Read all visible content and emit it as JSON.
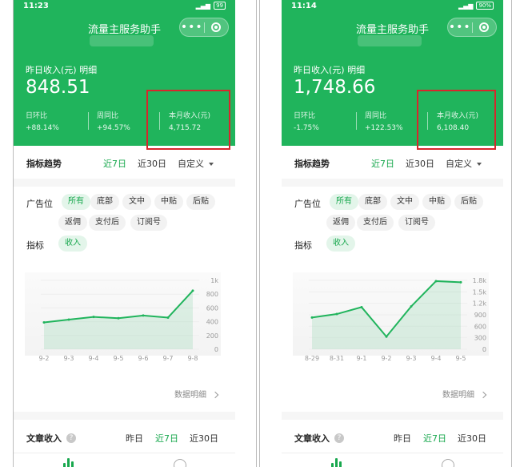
{
  "screens": [
    {
      "status_time": "11:23",
      "battery": "99",
      "app_title": "流量主服务助手",
      "yesterday_label": "昨日收入(元) 明细",
      "yesterday_value": "848.51",
      "stats": [
        {
          "label": "日环比",
          "value": "+88.14%"
        },
        {
          "label": "周同比",
          "value": "+94.57%"
        },
        {
          "label": "本月收入(元)",
          "value": "4,715.72"
        }
      ],
      "trend_label": "指标趋势",
      "trend_options": [
        "近7日",
        "近30日",
        "自定义"
      ],
      "ad_label": "广告位",
      "ad_chips": [
        "所有",
        "底部",
        "文中",
        "中贴",
        "后贴",
        "返佣",
        "支付后",
        "订阅号"
      ],
      "metric_label": "指标",
      "metric_chip": "收入",
      "chart_data": {
        "type": "line",
        "x": [
          "9-2",
          "9-3",
          "9-4",
          "9-5",
          "9-6",
          "9-7",
          "9-8"
        ],
        "series": [
          {
            "values": [
              390,
              430,
              470,
              450,
              490,
              460,
              850
            ]
          }
        ],
        "ylim": [
          0,
          1000
        ],
        "y_ticks": [
          "0",
          "200",
          "400",
          "600",
          "800",
          "1k"
        ]
      },
      "detail_link": "数据明细",
      "article_label": "文章收入",
      "article_options": [
        "昨日",
        "近7日",
        "近30日"
      ]
    },
    {
      "status_time": "11:14",
      "battery": "90%",
      "app_title": "流量主服务助手",
      "yesterday_label": "昨日收入(元) 明细",
      "yesterday_value": "1,748.66",
      "stats": [
        {
          "label": "日环比",
          "value": "-1.75%"
        },
        {
          "label": "周同比",
          "value": "+122.53%"
        },
        {
          "label": "本月收入(元)",
          "value": "6,108.40"
        }
      ],
      "trend_label": "指标趋势",
      "trend_options": [
        "近7日",
        "近30日",
        "自定义"
      ],
      "ad_label": "广告位",
      "ad_chips": [
        "所有",
        "底部",
        "文中",
        "中贴",
        "后贴",
        "返佣",
        "支付后",
        "订阅号"
      ],
      "metric_label": "指标",
      "metric_chip": "收入",
      "chart_data": {
        "type": "line",
        "x": [
          "8-29",
          "8-31",
          "9-1",
          "9-2",
          "9-3",
          "9-4",
          "9-5"
        ],
        "series": [
          {
            "values": [
              830,
              920,
              1100,
              330,
              1120,
              1780,
              1750
            ]
          }
        ],
        "ylim": [
          0,
          1800
        ],
        "y_ticks": [
          "0",
          "300",
          "600",
          "900",
          "1.2k",
          "1.5k",
          "1.8k"
        ]
      },
      "detail_link": "数据明细",
      "article_label": "文章收入",
      "article_options": [
        "昨日",
        "近7日",
        "近30日"
      ]
    }
  ],
  "colors": {
    "brand_green": "#20b45c",
    "accent_green": "#18a84e",
    "highlight_red": "#d8262c"
  }
}
